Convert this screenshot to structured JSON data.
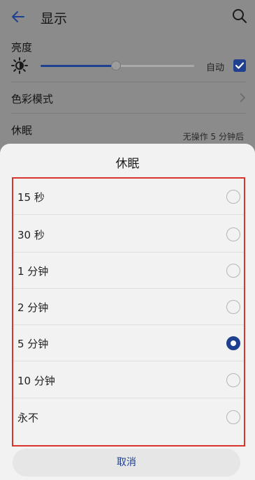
{
  "header": {
    "title": "显示"
  },
  "brightness": {
    "label": "亮度",
    "level_fraction": 0.49,
    "auto_label": "自动",
    "auto_checked": true
  },
  "color_mode": {
    "label": "色彩模式"
  },
  "sleep": {
    "title": "休眠",
    "value": "无操作 5 分钟后"
  },
  "dialog": {
    "title": "休眠",
    "options": [
      {
        "label": "15 秒",
        "selected": false
      },
      {
        "label": "30 秒",
        "selected": false
      },
      {
        "label": "1 分钟",
        "selected": false
      },
      {
        "label": "2 分钟",
        "selected": false
      },
      {
        "label": "5 分钟",
        "selected": true
      },
      {
        "label": "10 分钟",
        "selected": false
      },
      {
        "label": "永不",
        "selected": false
      }
    ],
    "cancel_label": "取消"
  },
  "colors": {
    "accent": "#1f3f8f",
    "highlight_border": "#d9342c"
  }
}
